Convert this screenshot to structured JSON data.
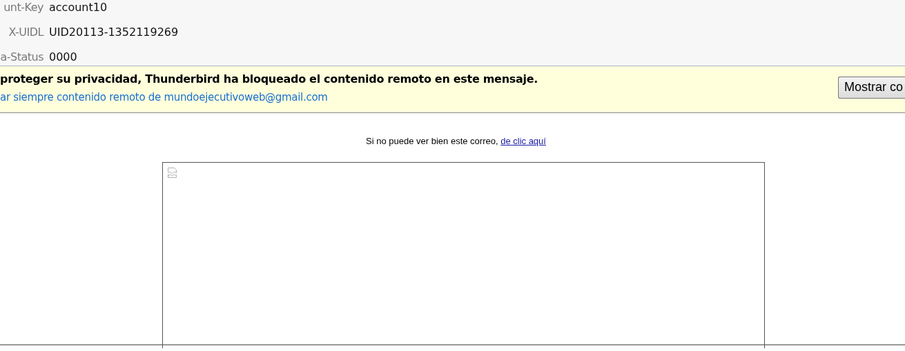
{
  "headers": [
    {
      "label": "unt-Key",
      "value": "account10"
    },
    {
      "label": "X-UIDL",
      "value": "UID20113-1352119269"
    },
    {
      "label": "a-Status",
      "value": "0000"
    }
  ],
  "notification": {
    "message": "proteger su privacidad, Thunderbird ha bloqueado el contenido remoto en este mensaje.",
    "link": "ar siempre contenido remoto de mundoejecutivoweb@gmail.com",
    "button": "Mostrar co"
  },
  "body": {
    "text": "Si no puede ver bien este correo, ",
    "link": "de clic aquí",
    "image": {
      "kind": "picture",
      "blocked": true
    }
  }
}
